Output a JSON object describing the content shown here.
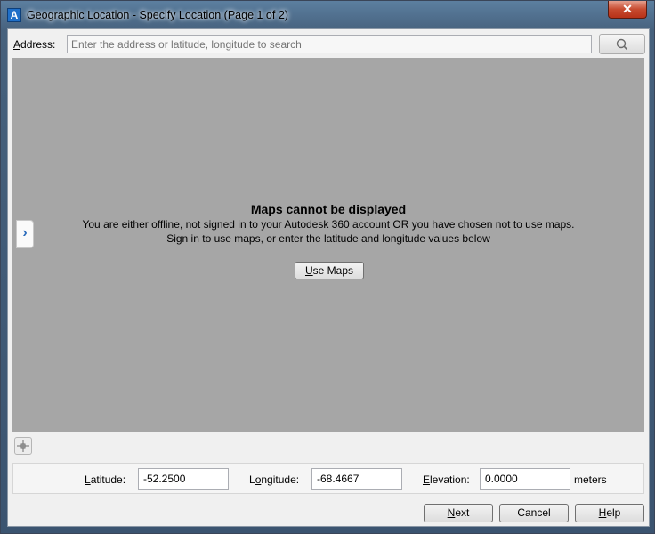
{
  "window": {
    "title": "Geographic Location - Specify Location (Page 1 of 2)",
    "close_glyph": "✕"
  },
  "address": {
    "label_key": "A",
    "label_rest": "ddress:",
    "placeholder": "Enter the address or latitude, longitude to search"
  },
  "map": {
    "side_tab_glyph": "›",
    "message_title": "Maps cannot be displayed",
    "message_line1": "You are either offline, not signed in to your Autodesk 360 account OR you have chosen not to use maps.",
    "message_line2": "Sign in to use maps, or enter the latitude and longitude values below",
    "use_maps_key": "U",
    "use_maps_rest": "se Maps"
  },
  "coords": {
    "latitude_label_key": "L",
    "latitude_label_rest": "atitude:",
    "latitude_value": "-52.2500",
    "longitude_label_pre": "L",
    "longitude_label_key": "o",
    "longitude_label_rest": "ngitude:",
    "longitude_value": "-68.4667",
    "elevation_label_key": "E",
    "elevation_label_rest": "levation:",
    "elevation_value": "0.0000",
    "elevation_unit": "meters"
  },
  "buttons": {
    "next_key": "N",
    "next_rest": "ext",
    "cancel": "Cancel",
    "help_key": "H",
    "help_rest": "elp"
  },
  "icons": {
    "app": "autocad-logo-icon",
    "search": "search-icon",
    "crosshair": "crosshair-icon",
    "expand": "chevron-right-icon"
  }
}
